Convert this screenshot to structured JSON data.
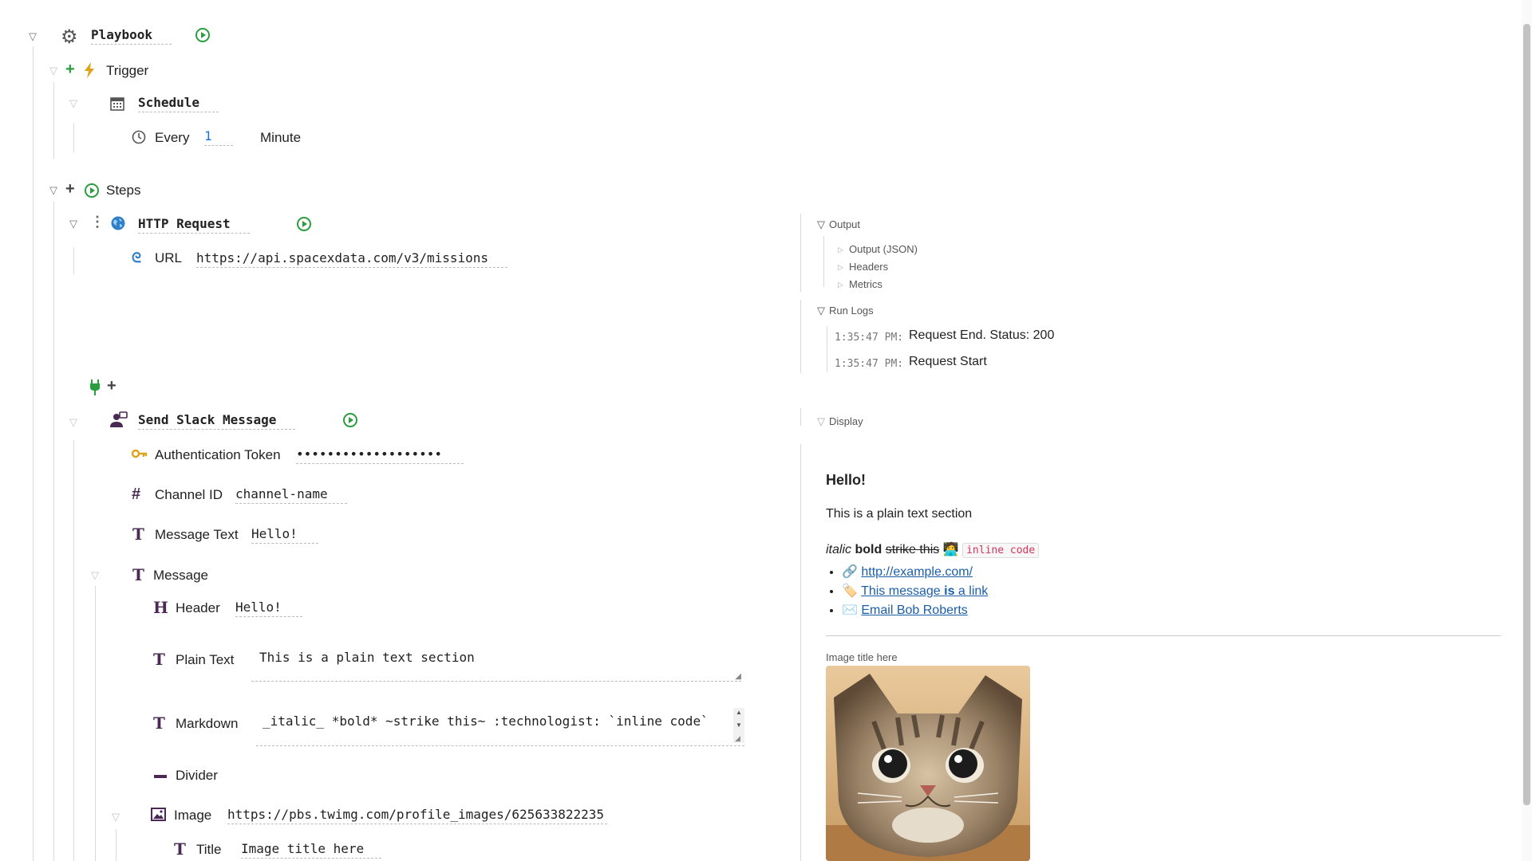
{
  "playbook": {
    "label": "Playbook"
  },
  "trigger": {
    "label": "Trigger"
  },
  "schedule": {
    "label": "Schedule",
    "every_label": "Every",
    "every_value": "1",
    "unit": "Minute"
  },
  "steps": {
    "label": "Steps"
  },
  "http": {
    "label": "HTTP Request",
    "url_label": "URL",
    "url_value": "https://api.spacexdata.com/v3/missions"
  },
  "slack": {
    "label": "Send Slack Message",
    "auth_label": "Authentication Token",
    "auth_value": "•••••••••••••••••••",
    "channel_label": "Channel ID",
    "channel_value": "channel-name",
    "msgtext_label": "Message Text",
    "msgtext_value": "Hello!",
    "message_label": "Message",
    "header_label": "Header",
    "header_value": "Hello!",
    "plain_label": "Plain Text",
    "plain_value": "This is a plain text section",
    "markdown_label": "Markdown",
    "markdown_value": "_italic_ *bold* ~strike this~ :technologist: `inline code`",
    "divider_label": "Divider",
    "image_label": "Image",
    "image_value": "https://pbs.twimg.com/profile_images/625633822235",
    "title_label": "Title",
    "title_value": "Image title here"
  },
  "output_panel": {
    "output_label": "Output",
    "items": [
      "Output (JSON)",
      "Headers",
      "Metrics"
    ],
    "runlogs_label": "Run Logs",
    "logs": [
      {
        "time": "1:35:47 PM:",
        "text": "Request End. Status: 200"
      },
      {
        "time": "1:35:47 PM:",
        "text": "Request Start"
      }
    ]
  },
  "display_panel": {
    "label": "Display",
    "heading": "Hello!",
    "plain": "This is a plain text section",
    "italic": "italic",
    "bold": "bold",
    "strike": "strike this",
    "emoji": "🧑‍💻",
    "code": "inline code",
    "links": [
      {
        "emoji": "🔗",
        "text": "http://example.com/"
      },
      {
        "emoji": "🏷️",
        "text_a": "This message ",
        "text_b": "is",
        "text_c": " a link"
      },
      {
        "emoji": "✉️",
        "text": "Email Bob Roberts"
      }
    ],
    "image_title": "Image title here"
  },
  "colors": {
    "run_green": "#2a9d3f",
    "link_blue": "#1a5ea8",
    "code_red": "#d3345b",
    "icon_purple": "#4a2a55"
  }
}
